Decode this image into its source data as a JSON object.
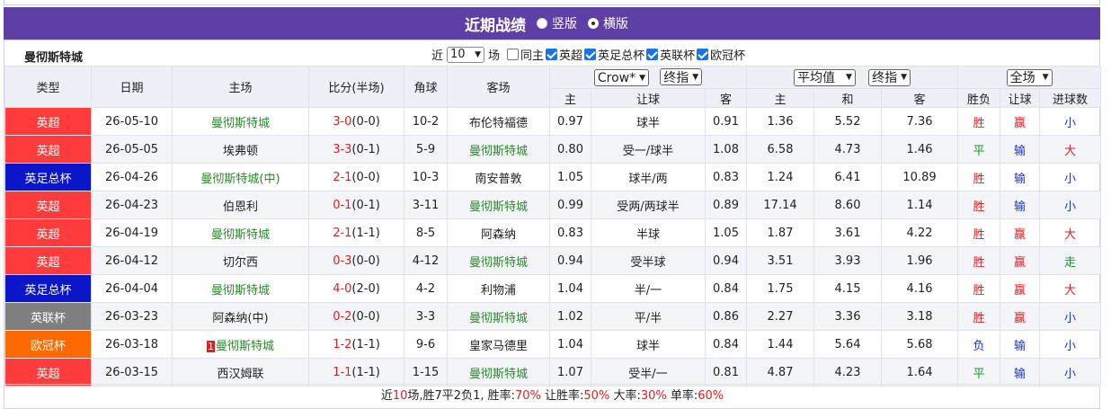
{
  "header": {
    "title": "近期战绩",
    "radio_vertical": "竖版",
    "radio_horizontal": "横版"
  },
  "filters": {
    "team": "曼彻斯特城",
    "near_label": "近",
    "count_value": "10",
    "matches_label": "场",
    "same_home_label": "同主",
    "league_checks": [
      {
        "label": "英超",
        "checked": true
      },
      {
        "label": "英足总杯",
        "checked": true
      },
      {
        "label": "英联杯",
        "checked": true
      },
      {
        "label": "欧冠杯",
        "checked": true
      }
    ]
  },
  "columns": {
    "type": "类型",
    "date": "日期",
    "home": "主场",
    "score": "比分(半场)",
    "corners": "角球",
    "away": "客场",
    "company_select": "Crow*",
    "handicap_select": "终指",
    "avg_select": "平均值",
    "avg_handicap_select": "终指",
    "full_select": "全场",
    "home_odds": "主",
    "handicap": "让球",
    "away_odds": "客",
    "eu_home": "主",
    "eu_draw": "和",
    "eu_away": "客",
    "result": "胜负",
    "handicap_result": "让球",
    "goals": "进球数"
  },
  "colors": {
    "purple_header": "#5e3fa6",
    "epl": "#ff3b3b",
    "fa_cup": "#0a16c8",
    "league_cup": "#7f7f7f",
    "ucl": "#ff6a00"
  },
  "rows": [
    {
      "league": "英超",
      "league_color": "#ff3b3b",
      "date": "26-05-10",
      "home": "曼彻斯特城",
      "home_team": "mc",
      "home_rank": "",
      "score_ft": "3-0",
      "score_ht": "(0-0)",
      "corners": "10-2",
      "away": "布伦特福德",
      "away_team": "other",
      "odds_home": "0.97",
      "handicap": "球半",
      "odds_away": "0.91",
      "eu_home": "1.36",
      "eu_draw": "5.52",
      "eu_away": "7.36",
      "result": "胜",
      "result_cls": "red",
      "hc_result": "赢",
      "hc_cls": "red",
      "goals": "小",
      "goals_cls": "blue"
    },
    {
      "league": "英超",
      "league_color": "#ff3b3b",
      "date": "26-05-05",
      "home": "埃弗顿",
      "home_team": "other",
      "home_rank": "",
      "score_ft": "3-3",
      "score_ht": "(0-1)",
      "corners": "5-9",
      "away": "曼彻斯特城",
      "away_team": "mc",
      "odds_home": "0.80",
      "handicap": "受一/球半",
      "odds_away": "1.08",
      "eu_home": "6.58",
      "eu_draw": "4.73",
      "eu_away": "1.46",
      "result": "平",
      "result_cls": "green2",
      "hc_result": "输",
      "hc_cls": "blue",
      "goals": "大",
      "goals_cls": "red"
    },
    {
      "league": "英足总杯",
      "league_color": "#0a16c8",
      "date": "26-04-26",
      "home": "曼彻斯特城(中)",
      "home_team": "mc",
      "home_rank": "",
      "score_ft": "2-1",
      "score_ht": "(0-0)",
      "corners": "10-3",
      "away": "南安普敦",
      "away_team": "other",
      "odds_home": "1.05",
      "handicap": "球半/两",
      "odds_away": "0.83",
      "eu_home": "1.24",
      "eu_draw": "6.41",
      "eu_away": "10.89",
      "result": "胜",
      "result_cls": "red",
      "hc_result": "输",
      "hc_cls": "blue",
      "goals": "小",
      "goals_cls": "blue"
    },
    {
      "league": "英超",
      "league_color": "#ff3b3b",
      "date": "26-04-23",
      "home": "伯恩利",
      "home_team": "other",
      "home_rank": "",
      "score_ft": "0-1",
      "score_ht": "(0-1)",
      "corners": "3-11",
      "away": "曼彻斯特城",
      "away_team": "mc",
      "odds_home": "0.99",
      "handicap": "受两/两球半",
      "odds_away": "0.89",
      "eu_home": "17.14",
      "eu_draw": "8.60",
      "eu_away": "1.14",
      "result": "胜",
      "result_cls": "red",
      "hc_result": "输",
      "hc_cls": "blue",
      "goals": "小",
      "goals_cls": "blue"
    },
    {
      "league": "英超",
      "league_color": "#ff3b3b",
      "date": "26-04-19",
      "home": "曼彻斯特城",
      "home_team": "mc",
      "home_rank": "",
      "score_ft": "2-1",
      "score_ht": "(1-1)",
      "corners": "8-5",
      "away": "阿森纳",
      "away_team": "other",
      "odds_home": "0.83",
      "handicap": "半球",
      "odds_away": "1.05",
      "eu_home": "1.87",
      "eu_draw": "3.61",
      "eu_away": "4.22",
      "result": "胜",
      "result_cls": "red",
      "hc_result": "赢",
      "hc_cls": "red",
      "goals": "大",
      "goals_cls": "red"
    },
    {
      "league": "英超",
      "league_color": "#ff3b3b",
      "date": "26-04-12",
      "home": "切尔西",
      "home_team": "other",
      "home_rank": "",
      "score_ft": "0-3",
      "score_ht": "(0-0)",
      "corners": "4-12",
      "away": "曼彻斯特城",
      "away_team": "mc",
      "odds_home": "0.94",
      "handicap": "受半球",
      "odds_away": "0.94",
      "eu_home": "3.51",
      "eu_draw": "3.93",
      "eu_away": "1.96",
      "result": "胜",
      "result_cls": "red",
      "hc_result": "赢",
      "hc_cls": "red",
      "goals": "走",
      "goals_cls": "green2"
    },
    {
      "league": "英足总杯",
      "league_color": "#0a16c8",
      "date": "26-04-04",
      "home": "曼彻斯特城",
      "home_team": "mc",
      "home_rank": "",
      "score_ft": "4-0",
      "score_ht": "(2-0)",
      "corners": "4-2",
      "away": "利物浦",
      "away_team": "other",
      "odds_home": "1.04",
      "handicap": "半/一",
      "odds_away": "0.84",
      "eu_home": "1.75",
      "eu_draw": "4.15",
      "eu_away": "4.16",
      "result": "胜",
      "result_cls": "red",
      "hc_result": "赢",
      "hc_cls": "red",
      "goals": "大",
      "goals_cls": "red"
    },
    {
      "league": "英联杯",
      "league_color": "#7f7f7f",
      "date": "26-03-23",
      "home": "阿森纳(中)",
      "home_team": "other",
      "home_rank": "",
      "score_ft": "0-2",
      "score_ht": "(0-0)",
      "corners": "3-3",
      "away": "曼彻斯特城",
      "away_team": "mc",
      "odds_home": "1.02",
      "handicap": "平/半",
      "odds_away": "0.86",
      "eu_home": "2.27",
      "eu_draw": "3.36",
      "eu_away": "3.18",
      "result": "胜",
      "result_cls": "red",
      "hc_result": "赢",
      "hc_cls": "red",
      "goals": "小",
      "goals_cls": "blue"
    },
    {
      "league": "欧冠杯",
      "league_color": "#ff6a00",
      "date": "26-03-18",
      "home": "曼彻斯特城",
      "home_team": "mc",
      "home_rank": "1",
      "score_ft": "1-2",
      "score_ht": "(1-1)",
      "corners": "9-6",
      "away": "皇家马德里",
      "away_team": "other",
      "odds_home": "1.04",
      "handicap": "球半",
      "odds_away": "0.84",
      "eu_home": "1.44",
      "eu_draw": "5.64",
      "eu_away": "5.68",
      "result": "负",
      "result_cls": "blue",
      "hc_result": "输",
      "hc_cls": "blue",
      "goals": "小",
      "goals_cls": "blue"
    },
    {
      "league": "英超",
      "league_color": "#ff3b3b",
      "date": "26-03-15",
      "home": "西汉姆联",
      "home_team": "other",
      "home_rank": "",
      "score_ft": "1-1",
      "score_ht": "(1-1)",
      "corners": "1-15",
      "away": "曼彻斯特城",
      "away_team": "mc",
      "odds_home": "1.07",
      "handicap": "受半/一",
      "odds_away": "0.81",
      "eu_home": "4.87",
      "eu_draw": "4.23",
      "eu_away": "1.64",
      "result": "平",
      "result_cls": "green2",
      "hc_result": "输",
      "hc_cls": "blue",
      "goals": "小",
      "goals_cls": "blue"
    }
  ],
  "summary": {
    "prefix": "近",
    "games": "10",
    "mid1": "场,胜7平2负1, 胜率:",
    "win_rate": "70%",
    "mid2": " 让胜率:",
    "hc_rate": "50%",
    "mid3": " 大率:",
    "big_rate": "30%",
    "mid4": " 单率:",
    "odd_rate": "60%"
  }
}
